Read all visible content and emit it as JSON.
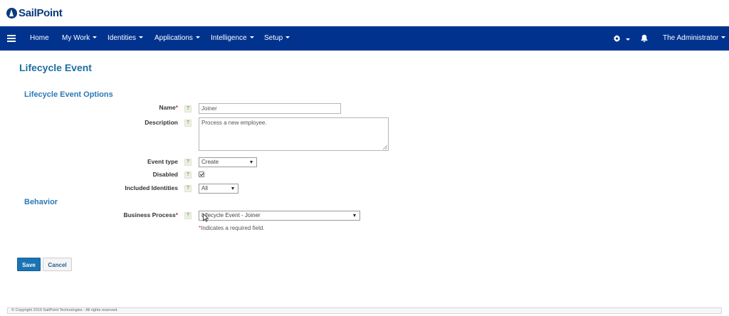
{
  "brand": {
    "logo_text": "SailPoint"
  },
  "nav": {
    "items": [
      {
        "label": "Home",
        "has_caret": false
      },
      {
        "label": "My Work",
        "has_caret": true
      },
      {
        "label": "Identities",
        "has_caret": true
      },
      {
        "label": "Applications",
        "has_caret": true
      },
      {
        "label": "Intelligence",
        "has_caret": true
      },
      {
        "label": "Setup",
        "has_caret": true
      }
    ],
    "user": "The Administrator",
    "icons": [
      "menu-icon",
      "gear-icon",
      "bell-icon"
    ]
  },
  "page": {
    "title": "Lifecycle Event"
  },
  "sections": {
    "options_title": "Lifecycle Event Options",
    "behavior_title": "Behavior"
  },
  "form": {
    "name": {
      "label": "Name",
      "required_mark": "*",
      "value": "Joiner"
    },
    "description": {
      "label": "Description",
      "value": "Process a new employee."
    },
    "event_type": {
      "label": "Event type",
      "value": "Create"
    },
    "disabled": {
      "label": "Disabled",
      "checked": true
    },
    "included_identities": {
      "label": "Included Identities",
      "value": "All"
    },
    "business_process": {
      "label": "Business Process",
      "required_mark": "*",
      "value": "Lifecycle Event - Joiner"
    },
    "help_glyph": "?",
    "required_note_mark": "*",
    "required_note": "Indicates a required field."
  },
  "actions": {
    "save": "Save",
    "cancel": "Cancel"
  },
  "footer": {
    "copyright": "© Copyright 2019 SailPoint Technologies - All rights reserved."
  },
  "colors": {
    "nav_bg": "#01338e",
    "accent": "#1b6ea3",
    "required": "#c0392b",
    "save_bg": "#1a73b4"
  }
}
